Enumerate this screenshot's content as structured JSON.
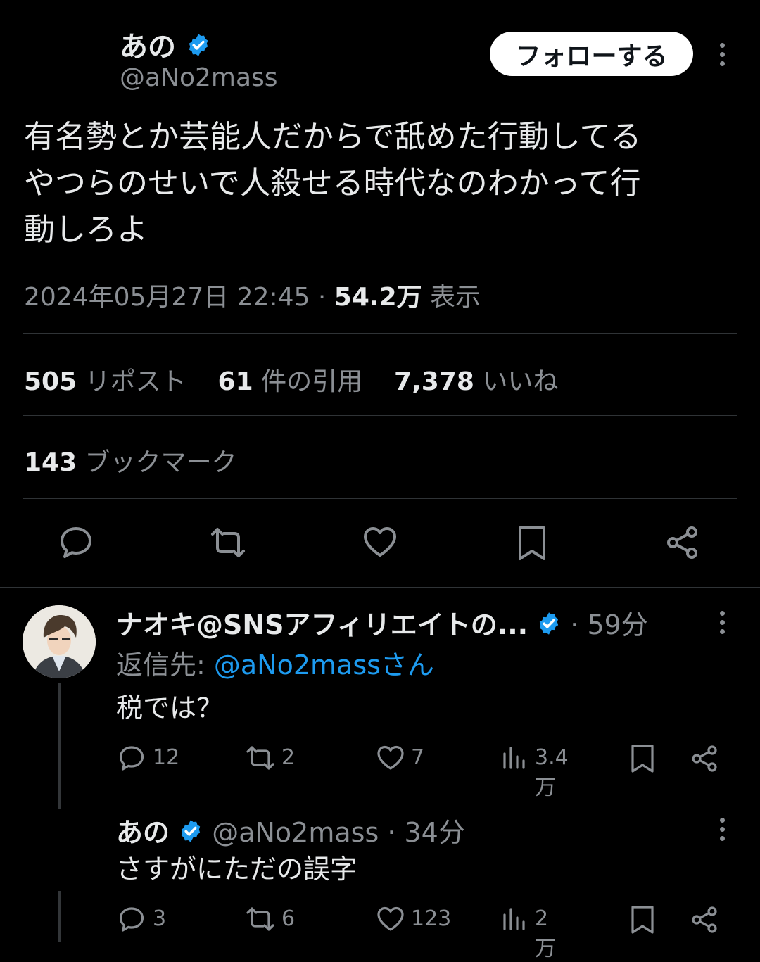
{
  "tweet": {
    "author_name": "あの",
    "author_handle": "@aNo2mass",
    "follow_label": "フォローする",
    "text_line1": "有名勢とか芸能人だからで舐めた行動してる",
    "text_line2": "やつらのせいで人殺せる時代なのわかって行",
    "text_line3": "動しろよ",
    "timestamp": "2024年05月27日 22:45",
    "separator": "·",
    "views_count": "54.2万",
    "views_label": "表示",
    "reposts_count": "505",
    "reposts_label": "リポスト",
    "quotes_count": "61",
    "quotes_label": "件の引用",
    "likes_count": "7,378",
    "likes_label": "いいね",
    "bookmarks_count": "143",
    "bookmarks_label": "ブックマーク"
  },
  "icons": {
    "reply": "reply-icon",
    "repost": "repost-icon",
    "like": "heart-icon",
    "bookmark": "bookmark-icon",
    "share": "share-icon",
    "views": "views-icon",
    "more": "more-icon",
    "verified": "verified-badge-icon"
  },
  "replies": [
    {
      "author_name": "ナオキ@SNSアフィリエイトの...",
      "time": "· 59分",
      "reply_to_prefix": "返信先: ",
      "reply_to_handle": "@aNo2massさん",
      "text": "税では？",
      "reply_count": "12",
      "repost_count": "2",
      "like_count": "7",
      "views_count": "3.4万"
    },
    {
      "author_name": "あの",
      "handle_time": "@aNo2mass · 34分",
      "text": "さすがにただの誤字",
      "reply_count": "3",
      "repost_count": "6",
      "like_count": "123",
      "views_count": "2万"
    }
  ],
  "colors": {
    "background": "#000000",
    "text": "#e7e9ea",
    "secondary": "#8b8f94",
    "accent": "#1d9bf0",
    "divider": "#2f3336"
  }
}
